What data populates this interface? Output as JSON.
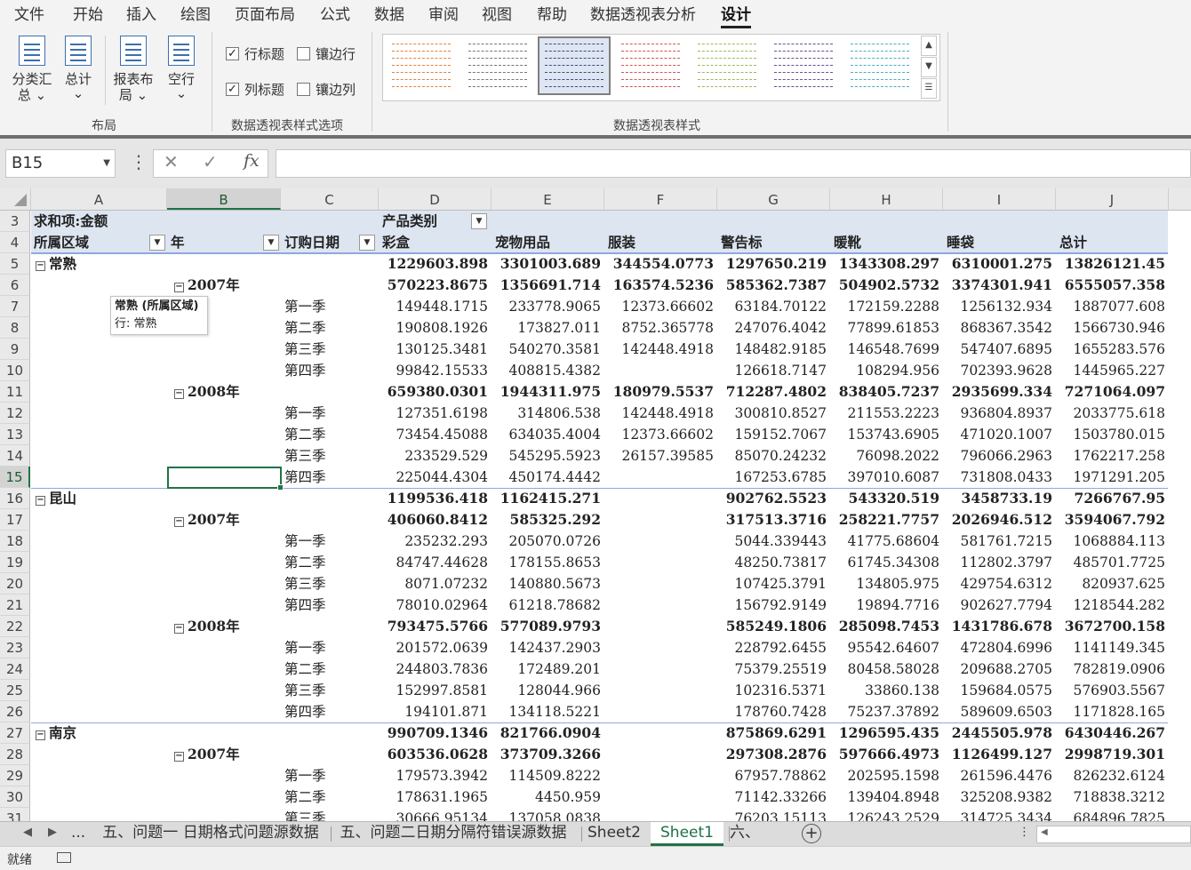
{
  "ribbon": {
    "tabs": [
      "文件",
      "开始",
      "插入",
      "绘图",
      "页面布局",
      "公式",
      "数据",
      "审阅",
      "视图",
      "帮助",
      "数据透视表分析",
      "设计"
    ],
    "active_tab": "设计",
    "layout_group": {
      "buttons": [
        {
          "line1": "分类汇",
          "line2": "总 ⌄"
        },
        {
          "line1": "总计",
          "line2": "⌄"
        },
        {
          "line1": "报表布",
          "line2": "局 ⌄"
        },
        {
          "line1": "空行",
          "line2": "⌄"
        }
      ],
      "label": "布局"
    },
    "style_options": {
      "checkboxes": [
        {
          "label": "行标题",
          "checked": true
        },
        {
          "label": "镶边行",
          "checked": false
        },
        {
          "label": "列标题",
          "checked": true
        },
        {
          "label": "镶边列",
          "checked": false
        }
      ],
      "label": "数据透视表样式选项"
    },
    "styles_group": {
      "label": "数据透视表样式",
      "swatch_colors": [
        "#e8813a",
        "#777777",
        "#3b4f7a",
        "#d9534f",
        "#9bbb59",
        "#6b4e9b",
        "#4bacc6"
      ],
      "selected_index": 2
    }
  },
  "formula_bar": {
    "name_box": "B15",
    "fx": "fx",
    "formula": ""
  },
  "grid": {
    "columns": [
      "A",
      "B",
      "C",
      "D",
      "E",
      "F",
      "G",
      "H",
      "I",
      "J"
    ],
    "selected_column": "B",
    "selected_row": "15",
    "header_row3": {
      "a": "求和项:金额",
      "d": "产品类别"
    },
    "header_row4": {
      "a": "所属区域",
      "b": "年",
      "c": "订购日期",
      "d": "彩盒",
      "e": "宠物用品",
      "f": "服装",
      "g": "警告标",
      "h": "暖靴",
      "i": "睡袋",
      "j": "总计"
    },
    "rows": [
      {
        "r": "5",
        "type": "region",
        "label": "常熟",
        "v": [
          "1229603.898",
          "3301003.689",
          "344554.0773",
          "1297650.219",
          "1343308.297",
          "6310001.275",
          "13826121.45"
        ]
      },
      {
        "r": "6",
        "type": "year",
        "label": "2007年",
        "v": [
          "570223.8675",
          "1356691.714",
          "163574.5236",
          "585362.7387",
          "504902.5732",
          "3374301.941",
          "6555057.358"
        ]
      },
      {
        "r": "7",
        "type": "q",
        "label": "第一季",
        "v": [
          "149448.1715",
          "233778.9065",
          "12373.66602",
          "63184.70122",
          "172159.2288",
          "1256132.934",
          "1887077.608"
        ]
      },
      {
        "r": "8",
        "type": "q",
        "label": "第二季",
        "v": [
          "190808.1926",
          "173827.011",
          "8752.365778",
          "247076.4042",
          "77899.61853",
          "868367.3542",
          "1566730.946"
        ]
      },
      {
        "r": "9",
        "type": "q",
        "label": "第三季",
        "v": [
          "130125.3481",
          "540270.3581",
          "142448.4918",
          "148482.9185",
          "146548.7699",
          "547407.6895",
          "1655283.576"
        ]
      },
      {
        "r": "10",
        "type": "q",
        "label": "第四季",
        "v": [
          "99842.15533",
          "408815.4382",
          "",
          "126618.7147",
          "108294.956",
          "702393.9628",
          "1445965.227"
        ]
      },
      {
        "r": "11",
        "type": "year",
        "label": "2008年",
        "v": [
          "659380.0301",
          "1944311.975",
          "180979.5537",
          "712287.4802",
          "838405.7237",
          "2935699.334",
          "7271064.097"
        ]
      },
      {
        "r": "12",
        "type": "q",
        "label": "第一季",
        "v": [
          "127351.6198",
          "314806.538",
          "142448.4918",
          "300810.8527",
          "211553.2223",
          "936804.8937",
          "2033775.618"
        ]
      },
      {
        "r": "13",
        "type": "q",
        "label": "第二季",
        "v": [
          "73454.45088",
          "634035.4004",
          "12373.66602",
          "159152.7067",
          "153743.6905",
          "471020.1007",
          "1503780.015"
        ]
      },
      {
        "r": "14",
        "type": "q",
        "label": "第三季",
        "v": [
          "233529.529",
          "545295.5923",
          "26157.39585",
          "85070.24232",
          "76098.2022",
          "796066.2963",
          "1762217.258"
        ]
      },
      {
        "r": "15",
        "type": "q",
        "label": "第四季",
        "v": [
          "225044.4304",
          "450174.4442",
          "",
          "167253.6785",
          "397010.6087",
          "731808.0433",
          "1971291.205"
        ]
      },
      {
        "r": "16",
        "type": "region",
        "label": "昆山",
        "v": [
          "1199536.418",
          "1162415.271",
          "",
          "902762.5523",
          "543320.519",
          "3458733.19",
          "7266767.95"
        ]
      },
      {
        "r": "17",
        "type": "year",
        "label": "2007年",
        "v": [
          "406060.8412",
          "585325.292",
          "",
          "317513.3716",
          "258221.7757",
          "2026946.512",
          "3594067.792"
        ]
      },
      {
        "r": "18",
        "type": "q",
        "label": "第一季",
        "v": [
          "235232.293",
          "205070.0726",
          "",
          "5044.339443",
          "41775.68604",
          "581761.7215",
          "1068884.113"
        ]
      },
      {
        "r": "19",
        "type": "q",
        "label": "第二季",
        "v": [
          "84747.44628",
          "178155.8653",
          "",
          "48250.73817",
          "61745.34308",
          "112802.3797",
          "485701.7725"
        ]
      },
      {
        "r": "20",
        "type": "q",
        "label": "第三季",
        "v": [
          "8071.07232",
          "140880.5673",
          "",
          "107425.3791",
          "134805.975",
          "429754.6312",
          "820937.625"
        ]
      },
      {
        "r": "21",
        "type": "q",
        "label": "第四季",
        "v": [
          "78010.02964",
          "61218.78682",
          "",
          "156792.9149",
          "19894.7716",
          "902627.7794",
          "1218544.282"
        ]
      },
      {
        "r": "22",
        "type": "year",
        "label": "2008年",
        "v": [
          "793475.5766",
          "577089.9793",
          "",
          "585249.1806",
          "285098.7453",
          "1431786.678",
          "3672700.158"
        ]
      },
      {
        "r": "23",
        "type": "q",
        "label": "第一季",
        "v": [
          "201572.0639",
          "142437.2903",
          "",
          "228792.6455",
          "95542.64607",
          "472804.6996",
          "1141149.345"
        ]
      },
      {
        "r": "24",
        "type": "q",
        "label": "第二季",
        "v": [
          "244803.7836",
          "172489.201",
          "",
          "75379.25519",
          "80458.58028",
          "209688.2705",
          "782819.0906"
        ]
      },
      {
        "r": "25",
        "type": "q",
        "label": "第三季",
        "v": [
          "152997.8581",
          "128044.966",
          "",
          "102316.5371",
          "33860.138",
          "159684.0575",
          "576903.5567"
        ]
      },
      {
        "r": "26",
        "type": "q",
        "label": "第四季",
        "v": [
          "194101.871",
          "134118.5221",
          "",
          "178760.7428",
          "75237.37892",
          "589609.6503",
          "1171828.165"
        ]
      },
      {
        "r": "27",
        "type": "region",
        "label": "南京",
        "v": [
          "990709.1346",
          "821766.0904",
          "",
          "875869.6291",
          "1296595.435",
          "2445505.978",
          "6430446.267"
        ]
      },
      {
        "r": "28",
        "type": "year",
        "label": "2007年",
        "v": [
          "603536.0628",
          "373709.3266",
          "",
          "297308.2876",
          "597666.4973",
          "1126499.127",
          "2998719.301"
        ]
      },
      {
        "r": "29",
        "type": "q",
        "label": "第一季",
        "v": [
          "179573.3942",
          "114509.8222",
          "",
          "67957.78862",
          "202595.1598",
          "261596.4476",
          "826232.6124"
        ]
      },
      {
        "r": "30",
        "type": "q",
        "label": "第二季",
        "v": [
          "178631.1965",
          "4450.959",
          "",
          "71142.33266",
          "139404.8948",
          "325208.9382",
          "718838.3212"
        ]
      },
      {
        "r": "31",
        "type": "q",
        "label": "第三季",
        "v": [
          "30666.95134",
          "137058.0838",
          "",
          "76203.15113",
          "126243.2529",
          "314725.3434",
          "684896.7825"
        ]
      }
    ],
    "tooltip": {
      "line1": "常熟 (所属区域)",
      "line2": "行: 常熟"
    }
  },
  "sheet_tabs": {
    "ellipsis": "...",
    "tabs": [
      "五、问题一 日期格式问题源数据",
      "五、问题二日期分隔符错误源数据",
      "Sheet2",
      "Sheet1",
      "六、"
    ],
    "active": "Sheet1",
    "add_label": "+"
  },
  "status": {
    "text": "就绪"
  }
}
